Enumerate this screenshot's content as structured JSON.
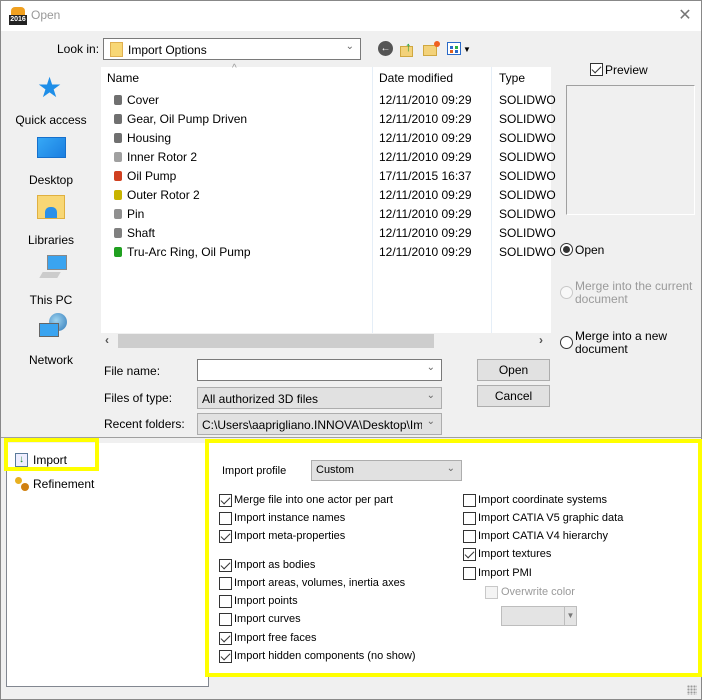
{
  "window": {
    "title": "Open",
    "app_badge": "2016",
    "close_icon": "close-icon"
  },
  "toolbar": {
    "look_in_label": "Look in:",
    "look_in_value": "Import Options",
    "icons": [
      "back-icon",
      "up-folder-icon",
      "new-folder-icon",
      "view-menu-icon"
    ]
  },
  "places": [
    {
      "label": "Quick access",
      "icon": "quick-access-star-icon"
    },
    {
      "label": "Desktop",
      "icon": "desktop-icon"
    },
    {
      "label": "Libraries",
      "icon": "libraries-icon"
    },
    {
      "label": "This PC",
      "icon": "this-pc-icon"
    },
    {
      "label": "Network",
      "icon": "network-icon"
    }
  ],
  "file_list": {
    "columns": [
      "Name",
      "Date modified",
      "Type"
    ],
    "rows": [
      {
        "name": "Cover",
        "date": "12/11/2010 09:29",
        "type": "SOLIDWO",
        "icon_color": "#707070"
      },
      {
        "name": "Gear, Oil Pump Driven",
        "date": "12/11/2010 09:29",
        "type": "SOLIDWO",
        "icon_color": "#707070"
      },
      {
        "name": "Housing",
        "date": "12/11/2010 09:29",
        "type": "SOLIDWO",
        "icon_color": "#707070"
      },
      {
        "name": "Inner Rotor 2",
        "date": "12/11/2010 09:29",
        "type": "SOLIDWO",
        "icon_color": "#a0a0a0"
      },
      {
        "name": "Oil Pump",
        "date": "17/11/2015 16:37",
        "type": "SOLIDWO",
        "icon_color": "#d04020"
      },
      {
        "name": "Outer Rotor 2",
        "date": "12/11/2010 09:29",
        "type": "SOLIDWO",
        "icon_color": "#c8b400"
      },
      {
        "name": "Pin",
        "date": "12/11/2010 09:29",
        "type": "SOLIDWO",
        "icon_color": "#909090"
      },
      {
        "name": "Shaft",
        "date": "12/11/2010 09:29",
        "type": "SOLIDWO",
        "icon_color": "#808080"
      },
      {
        "name": "Tru-Arc Ring, Oil Pump",
        "date": "12/11/2010 09:29",
        "type": "SOLIDWO",
        "icon_color": "#20a020"
      }
    ]
  },
  "preview": {
    "label": "Preview",
    "checked": true
  },
  "open_mode": {
    "options": [
      {
        "label": "Open",
        "selected": true,
        "disabled": false
      },
      {
        "label": "Merge into the current document",
        "selected": false,
        "disabled": true
      },
      {
        "label": "Merge into a new document",
        "selected": false,
        "disabled": false
      }
    ]
  },
  "fields": {
    "file_name_label": "File name:",
    "file_name_value": "",
    "files_of_type_label": "Files of type:",
    "files_of_type_value": "All authorized 3D files",
    "recent_folders_label": "Recent folders:",
    "recent_folders_value": "C:\\Users\\aaprigliano.INNOVA\\Desktop\\Import"
  },
  "buttons": {
    "open": "Open",
    "cancel": "Cancel"
  },
  "tree": {
    "items": [
      {
        "label": "Import",
        "icon": "import-icon",
        "highlighted": true
      },
      {
        "label": "Refinement",
        "icon": "refinement-icon",
        "highlighted": false
      }
    ]
  },
  "import_options": {
    "profile_label": "Import profile",
    "profile_value": "Custom",
    "left_column": [
      {
        "label": "Merge file into one actor per part",
        "checked": true
      },
      {
        "label": "Import instance names",
        "checked": false
      },
      {
        "label": "Import meta-properties",
        "checked": true
      },
      {
        "label": "Import as bodies",
        "checked": true
      },
      {
        "label": "Import areas, volumes, inertia axes",
        "checked": false
      },
      {
        "label": "Import points",
        "checked": false
      },
      {
        "label": "Import curves",
        "checked": false
      },
      {
        "label": "Import free faces",
        "checked": true
      },
      {
        "label": "Import hidden components (no show)",
        "checked": true
      }
    ],
    "right_column": [
      {
        "label": "Import coordinate systems",
        "checked": false
      },
      {
        "label": "Import CATIA V5 graphic data",
        "checked": false
      },
      {
        "label": "Import CATIA V4 hierarchy",
        "checked": false
      },
      {
        "label": "Import textures",
        "checked": true
      },
      {
        "label": "Import PMI",
        "checked": false
      }
    ],
    "overwrite_color": {
      "label": "Overwrite color",
      "checked": false,
      "disabled": true
    },
    "color_combo_value": ""
  },
  "colors": {
    "highlight": "#ffff00"
  }
}
